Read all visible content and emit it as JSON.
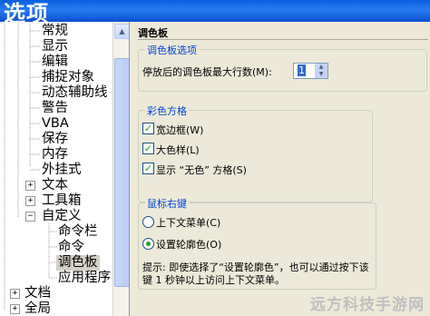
{
  "window": {
    "title": "选项"
  },
  "tree": {
    "items": [
      {
        "label": "常规"
      },
      {
        "label": "显示"
      },
      {
        "label": "编辑"
      },
      {
        "label": "捕捉对象"
      },
      {
        "label": "动态辅助线"
      },
      {
        "label": "警告"
      },
      {
        "label": "VBA"
      },
      {
        "label": "保存"
      },
      {
        "label": "内存"
      },
      {
        "label": "外挂式"
      },
      {
        "label": "文本"
      },
      {
        "label": "工具箱"
      },
      {
        "label": "自定义"
      },
      {
        "label": "命令栏"
      },
      {
        "label": "命令"
      },
      {
        "label": "调色板"
      },
      {
        "label": "应用程序"
      },
      {
        "label": "文档"
      },
      {
        "label": "全局"
      }
    ],
    "selected": "调色板"
  },
  "panel": {
    "title": "调色板",
    "palette_options": {
      "title": "调色板选项",
      "max_rows_label": "停放后的调色板最大行数(M):",
      "max_rows_value": "1"
    },
    "swatches": {
      "title": "彩色方格",
      "options": [
        {
          "label": "宽边框(W)",
          "checked": true
        },
        {
          "label": "大色样(L)",
          "checked": true
        },
        {
          "label": "显示 “无色” 方格(S)",
          "checked": true
        }
      ]
    },
    "right_click": {
      "title": "鼠标右键",
      "options": [
        {
          "label": "上下文菜单(C)",
          "selected": false
        },
        {
          "label": "设置轮廓色(O)",
          "selected": true
        }
      ],
      "hint_line1": "提示: 即使选择了“设置轮廓色”，也可以通过按下该",
      "hint_line2": "键 1 秒钟以上访问上下文菜单。"
    }
  },
  "watermark": "远方科技手游网",
  "colors": {
    "title_bar": "#0a5fe0",
    "group_title": "#0046d5",
    "check": "#21a121"
  }
}
